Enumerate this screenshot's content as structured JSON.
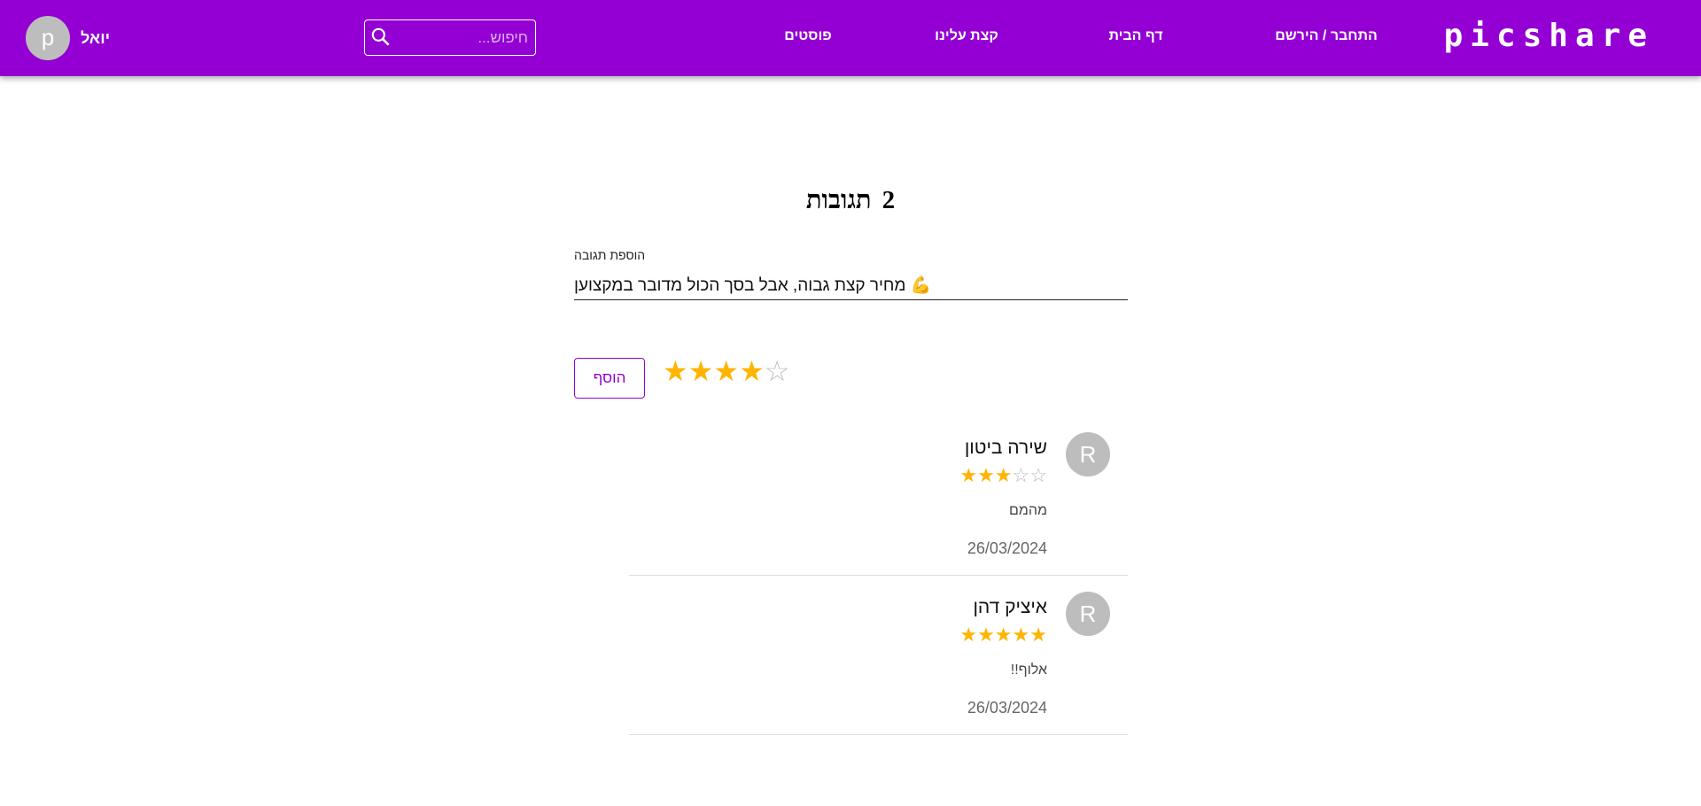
{
  "header": {
    "logo": "picshare",
    "nav": [
      "התחבר / הירשם",
      "דף הבית",
      "קצת עלינו",
      "פוסטים"
    ],
    "search_placeholder": "חיפוש...",
    "user_initial": "p",
    "user_name": "יואל",
    "bg_color": "#9400d3"
  },
  "comments_section": {
    "count": "2",
    "title": "תגובות",
    "input_label": "הוספת תגובה",
    "input_value": "💪 מחיר קצת גבוה, אבל בסך הכול מדובר במקצוען",
    "rating": 4,
    "max_rating": 5,
    "add_label": "הוסף"
  },
  "comments": [
    {
      "initial": "R",
      "name": "שירה ביטון",
      "rating": 3,
      "text": "מהמם",
      "date": "26/03/2024"
    },
    {
      "initial": "R",
      "name": "איציק דהן",
      "rating": 5,
      "text": "אלוף!!",
      "date": "26/03/2024"
    }
  ],
  "star_color": "#ffb400"
}
